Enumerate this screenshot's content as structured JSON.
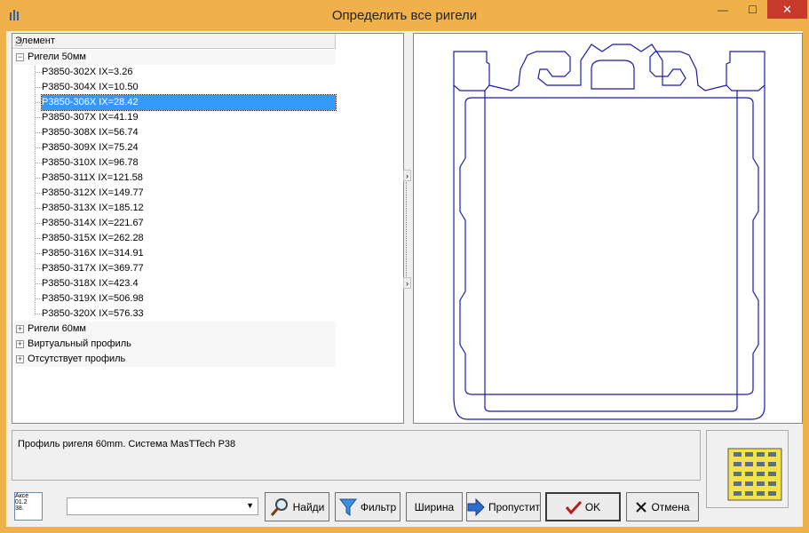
{
  "window": {
    "title": "Определить все ригели",
    "min_glyph": "—",
    "max_glyph": "☐",
    "close_glyph": "✕"
  },
  "tree": {
    "header": "Элемент",
    "groups": [
      {
        "label": "Ригели 50мм",
        "expanded": true,
        "items": [
          "P3850-302X IX=3.26",
          "P3850-304X IX=10.50",
          "P3850-306X IX=28.42",
          "P3850-307X IX=41.19",
          "P3850-308X IX=56.74",
          "P3850-309X IX=75.24",
          "P3850-310X IX=96.78",
          "P3850-311X IX=121.58",
          "P3850-312X IX=149.77",
          "P3850-313X IX=185.12",
          "P3850-314X IX=221.67",
          "P3850-315X IX=262.28",
          "P3850-316X IX=314.91",
          "P3850-317X IX=369.77",
          "P3850-318X IX=423.4",
          "P3850-319X IX=506.98",
          "P3850-320X IX=576.33"
        ]
      },
      {
        "label": "Ригели 60мм",
        "expanded": false,
        "items": []
      },
      {
        "label": "Виртуальный профиль",
        "expanded": false,
        "items": []
      },
      {
        "label": "Отсутствует профиль",
        "expanded": false,
        "items": []
      }
    ],
    "selected": "P3850-306X IX=28.42"
  },
  "description": "Профиль ригеля 60mm. Система MasTTech P38",
  "access_icon_lines": [
    "Акce",
    "01.2",
    "38."
  ],
  "search_combo": {
    "value": ""
  },
  "buttons": {
    "find": "Найди",
    "filter": "Фильтр",
    "width": "Ширина",
    "skip": "Пропустит",
    "ok": "OK",
    "cancel": "Отмена"
  },
  "colors": {
    "window_frame": "#f0b04a",
    "close_button": "#c7392b",
    "selection": "#3399ff",
    "profile_stroke": "#1a1aa6"
  }
}
